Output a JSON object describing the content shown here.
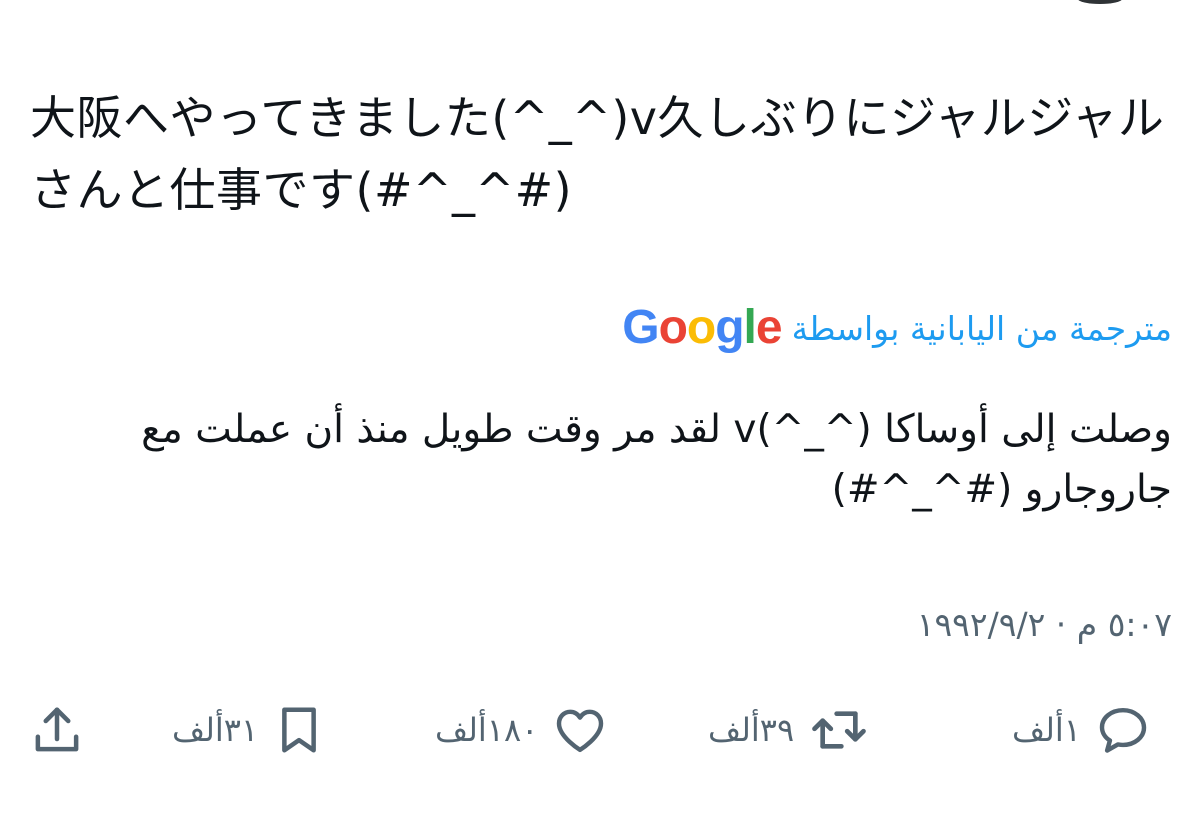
{
  "tweet": {
    "original_text": "大阪へやってきました(^_^)v久しぶりにジャルジャルさんと仕事です(#^_^#)",
    "translated_by_label": "مترجمة من اليابانية بواسطة",
    "translator_logo": "Google",
    "translation_text": "وصلت إلى أوساكا (^_^)v لقد مر وقت طويل منذ أن عملت مع جاروجارو (#^_^#)",
    "timestamp": "٥:٠٧ م · ١٩٩٢/٩/٢"
  },
  "actions": {
    "reply": {
      "icon": "reply-icon",
      "count": "١ألف"
    },
    "retweet": {
      "icon": "retweet-icon",
      "count": "٣٩ألف"
    },
    "like": {
      "icon": "heart-icon",
      "count": "١٨٠ألف"
    },
    "bookmark": {
      "icon": "bookmark-icon",
      "count": "٣١ألف"
    },
    "share": {
      "icon": "share-icon"
    }
  },
  "colors": {
    "text": "#0f1419",
    "secondary": "#536471",
    "link": "#1d9bf0",
    "google_blue": "#4285f4",
    "google_red": "#ea4335",
    "google_yellow": "#fbbc05",
    "google_green": "#34a853"
  }
}
